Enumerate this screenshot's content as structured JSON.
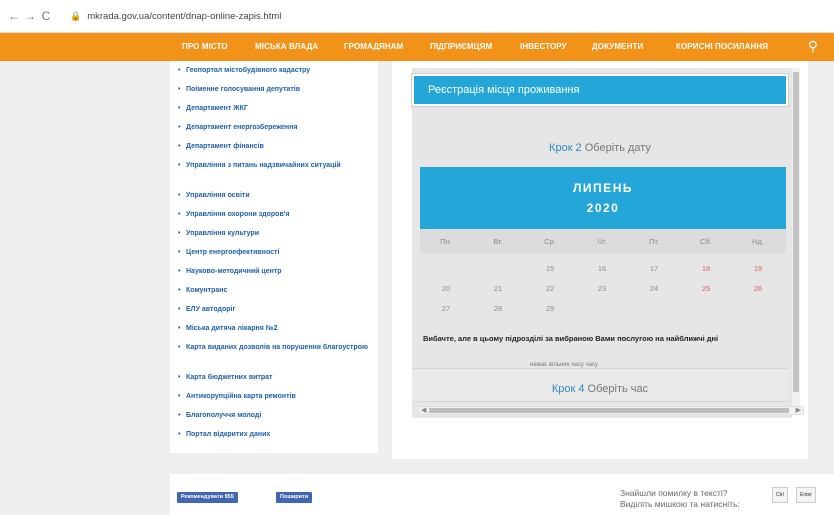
{
  "browser": {
    "back": "←",
    "forward": "→",
    "reload": "C",
    "url": "mkrada.gov.ua/content/dnap-online-zapis.html"
  },
  "nav": {
    "items": [
      "ПРО МІСТО",
      "МІСЬКА ВЛАДА",
      "ГРОМАДЯНАМ",
      "ПІДПРИЄМЦЯМ",
      "ІНВЕСТОРУ",
      "ДОКУМЕНТИ",
      "КОРИСНІ ПОСИЛАННЯ"
    ],
    "accent": "#f39219"
  },
  "sidebar": {
    "items": [
      "Геопортал містобудівного кадастру",
      "Поіменне голосування депутатів",
      "Департамент ЖКГ",
      "Департамент енергозбереження",
      "Департамент фінансів",
      "Управління з питань надзвичайних ситуацій",
      "Управління освіти",
      "Управління охорони здоров'я",
      "Управління культури",
      "Центр енергоефективності",
      "Науково-методичний центр",
      "Комунтранс",
      "ЕЛУ автодоріг",
      "Міська дитяча лікарня №2",
      "Карта виданих дозволів на порушення благоустрою",
      "Карта бюджетних витрат",
      "Антикорупційна карта ремонтів",
      "Благополуччя молоді",
      "Портал відкритих даних"
    ]
  },
  "form": {
    "title": "Реєстрація місця проживання",
    "step2_num": "Крок 2",
    "step2_text": " Оберіть дату",
    "month": "ЛИПЕНЬ",
    "year": "2020",
    "weekdays": [
      "Пн.",
      "Вт.",
      "Ср.",
      "Чт.",
      "Пт.",
      "Сб.",
      "Нд."
    ],
    "weeks": [
      [
        "",
        "",
        "15",
        "16",
        "17",
        "18",
        "19"
      ],
      [
        "20",
        "21",
        "22",
        "23",
        "24",
        "25",
        "26"
      ],
      [
        "27",
        "28",
        "29",
        "",
        "",
        "",
        ""
      ]
    ],
    "warning": "Вибачте, але в цьому підрозділі за вибраною Вами послугою на найближчі дні",
    "warning_cut": "немає вільних часу часу",
    "step4_num": "Крок 4",
    "step4_text": " Оберіть час",
    "header_color": "#24a6d8"
  },
  "footer": {
    "recommend": "Рекомендувати 955",
    "share": "Поширити",
    "typo_line1": "Знайшли помилку в тексті?",
    "typo_line2": "Виділіть мишкою та натисніть:",
    "key1": "Ctrl",
    "key2": "Enter"
  }
}
